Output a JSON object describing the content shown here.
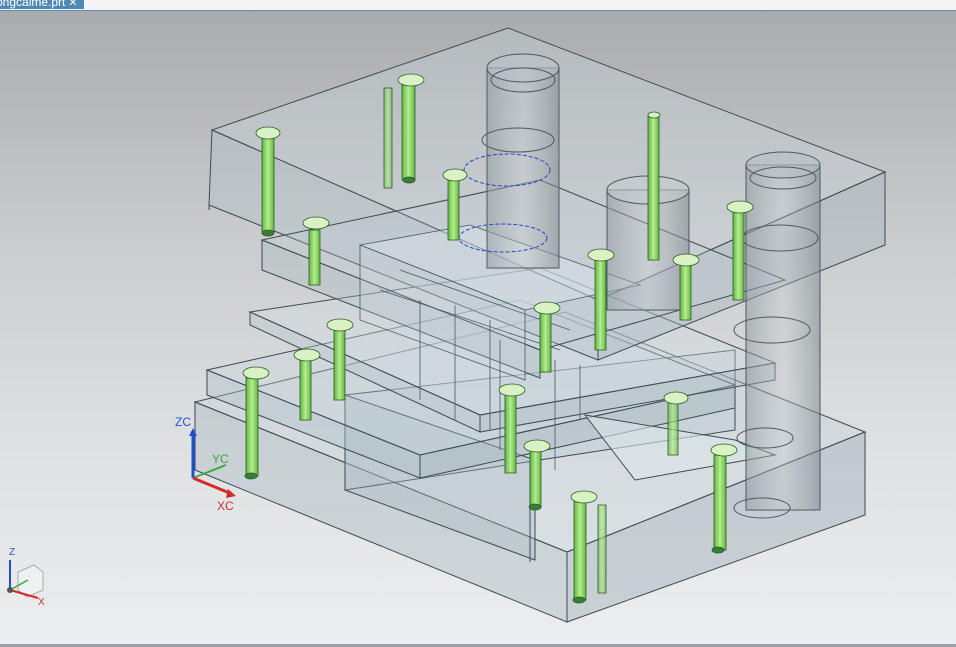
{
  "tab": {
    "title": "ongcaime.prt",
    "close_glyph": "✕"
  },
  "wcs": {
    "z_label": "ZC",
    "y_label": "YC",
    "x_label": "XC"
  },
  "view_triad": {
    "z_label": "Z",
    "x_label": "X"
  },
  "colors": {
    "pin_fill": "#7fd15a",
    "plate_fill": "#c8d6dc",
    "edge": "#3c4a52",
    "z_axis": "#1f4fd6",
    "x_axis": "#d42a2a",
    "y_axis": "#3aa83a"
  }
}
